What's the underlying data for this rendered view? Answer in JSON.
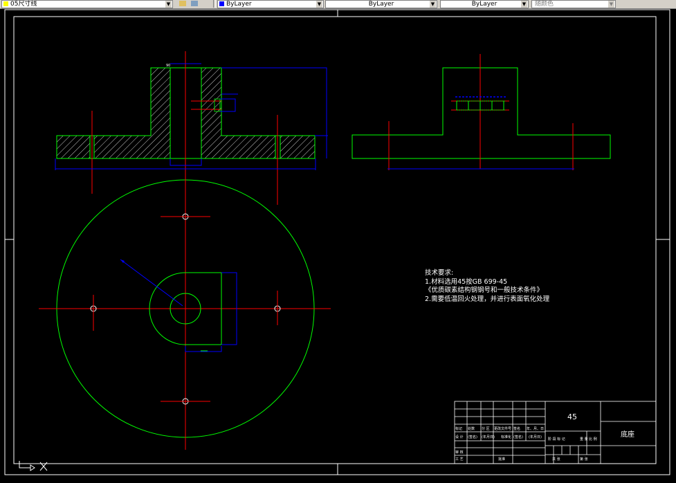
{
  "toolbar": {
    "layer_combo": "05尺寸线",
    "color_combo": "ByLayer",
    "linetype_combo": "ByLayer",
    "lineweight_combo": "ByLayer",
    "plotstyle_combo": "随颜色"
  },
  "notes": {
    "title": "技术要求:",
    "line1": "1.材料选用45按GB 699-45",
    "line2": "《优质碳素结构钢钢号和一般技术条件》",
    "line3": "2.需要低温回火处理，并进行表面氧化处理"
  },
  "title_block": {
    "material": "45",
    "part_name": "底座",
    "row_labels": [
      "标记",
      "处数",
      "分 区",
      "更改文件号",
      "签名",
      "年、月、日"
    ],
    "row2_labels": [
      "设 计",
      "(签名)",
      "(年月日)",
      "标准化",
      "(签名)",
      "(年月日)"
    ],
    "stage_labels": [
      "阶 段 标 记",
      "重 量",
      "比 例"
    ],
    "sheet_labels": [
      "共 张",
      "第 张"
    ],
    "review_label": "审 核",
    "process_label": "工 艺",
    "approve_label": "批准"
  },
  "colors": {
    "outline": "#00ff00",
    "centerline": "#ff0000",
    "dimension": "#0000ff",
    "frame": "#ffffff",
    "background": "#000000"
  }
}
